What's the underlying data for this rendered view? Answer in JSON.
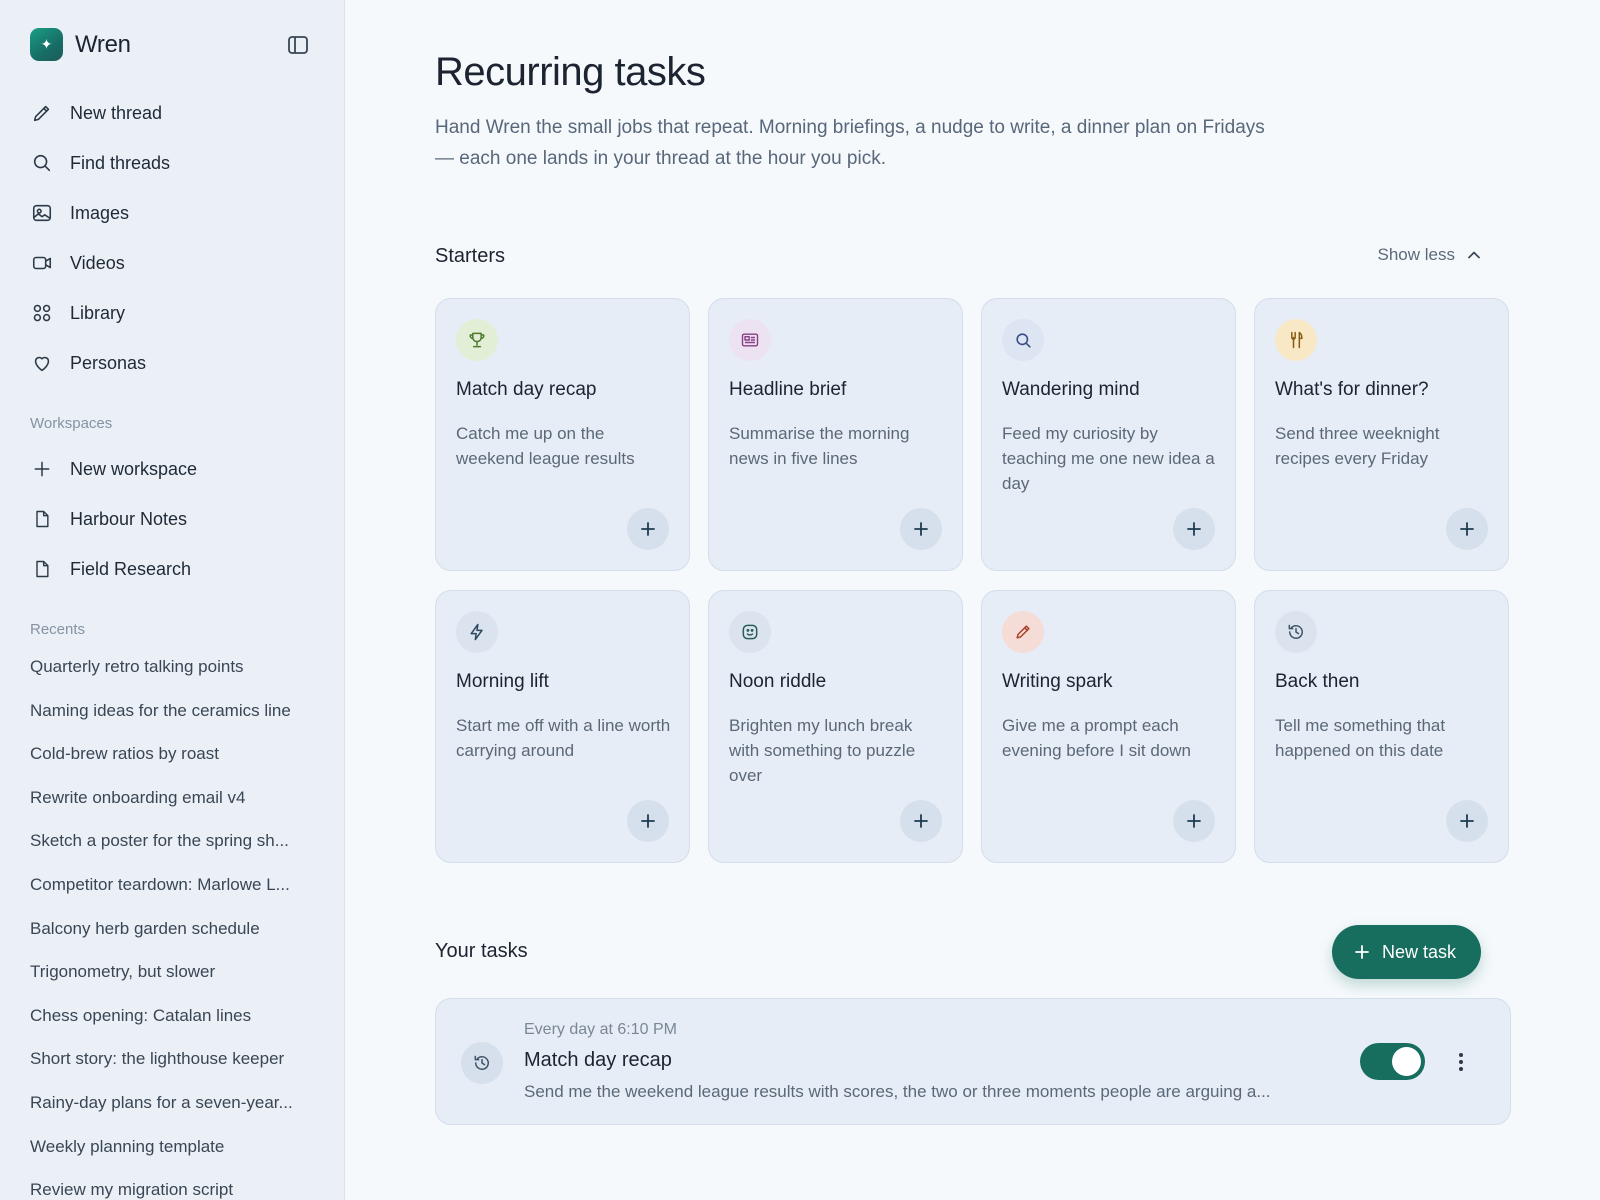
{
  "sidebar": {
    "brand": "Wren",
    "nav": [
      {
        "label": "New thread",
        "icon": "pencil-icon"
      },
      {
        "label": "Find threads",
        "icon": "search-icon"
      },
      {
        "label": "Images",
        "icon": "image-icon"
      },
      {
        "label": "Videos",
        "icon": "video-icon"
      },
      {
        "label": "Library",
        "icon": "grid-icon"
      },
      {
        "label": "Personas",
        "icon": "heart-icon"
      }
    ],
    "workspaces_label": "Workspaces",
    "workspaces": [
      {
        "label": "New workspace",
        "icon": "plus-icon"
      },
      {
        "label": "Harbour Notes",
        "icon": "document-icon"
      },
      {
        "label": "Field Research",
        "icon": "document-icon"
      }
    ],
    "recents_label": "Recents",
    "recents": [
      "Quarterly retro talking points",
      "Naming ideas for the ceramics line",
      "Cold-brew ratios by roast",
      "Rewrite onboarding email v4",
      "Sketch a poster for the spring sh...",
      "Competitor teardown: Marlowe L...",
      "Balcony herb garden schedule",
      "Trigonometry, but slower",
      "Chess opening: Catalan lines",
      "Short story: the lighthouse keeper",
      "Rainy-day plans for a seven-year...",
      "Weekly planning template",
      "Review my migration script"
    ]
  },
  "main": {
    "title": "Recurring tasks",
    "description": "Hand Wren the small jobs that repeat. Morning briefings, a nudge to write, a dinner plan on Fridays — each one lands in your thread at the hour you pick.",
    "starters_label": "Starters",
    "show_less_label": "Show less",
    "starters": [
      {
        "title": "Match day recap",
        "desc": "Catch me up on the weekend league results",
        "icon": "trophy-icon",
        "icon_bg": "#e2efd6",
        "icon_color": "#4e7a2e"
      },
      {
        "title": "Headline brief",
        "desc": "Summarise the morning news in five lines",
        "icon": "newspaper-icon",
        "icon_bg": "#ece2f1",
        "icon_color": "#8a3f86"
      },
      {
        "title": "Wandering mind",
        "desc": "Feed my curiosity by teaching me one new idea a day",
        "icon": "search-icon",
        "icon_bg": "#dee5f2",
        "icon_color": "#3a4e86"
      },
      {
        "title": "What's for dinner?",
        "desc": "Send three weeknight recipes every Friday",
        "icon": "fork-knife-icon",
        "icon_bg": "#f8e8c6",
        "icon_color": "#8a5a12"
      },
      {
        "title": "Morning lift",
        "desc": "Start me off with a line worth carrying around",
        "icon": "lightning-icon",
        "icon_bg": "#dbe4ee",
        "icon_color": "#2f4a60"
      },
      {
        "title": "Noon riddle",
        "desc": "Brighten my lunch break with something to puzzle over",
        "icon": "smiley-icon",
        "icon_bg": "#dbe4ee",
        "icon_color": "#2a5c5a"
      },
      {
        "title": "Writing spark",
        "desc": "Give me a prompt each evening before I sit down",
        "icon": "pencil-icon",
        "icon_bg": "#f6dcd6",
        "icon_color": "#a8442e"
      },
      {
        "title": "Back then",
        "desc": "Tell me something that happened on this date",
        "icon": "history-icon",
        "icon_bg": "#dbe4ee",
        "icon_color": "#3f5366"
      }
    ],
    "your_tasks_label": "Your tasks",
    "new_task_label": "New task",
    "tasks": [
      {
        "schedule": "Every day at 6:10 PM",
        "title": "Match day recap",
        "desc": "Send me the weekend league results with scores, the two or three moments people are arguing a...",
        "enabled": true,
        "icon": "history-icon"
      }
    ]
  },
  "colors": {
    "accent": "#176e5e",
    "sidebar_bg": "#eaf0f6",
    "card_bg": "#e6edf6"
  }
}
